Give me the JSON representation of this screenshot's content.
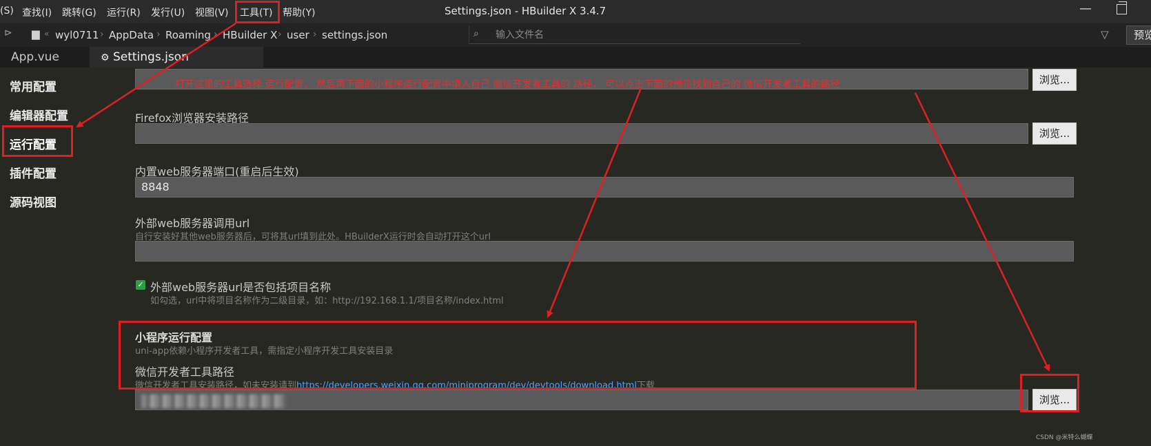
{
  "menu": {
    "items": [
      "(S)",
      "查找(I)",
      "跳转(G)",
      "运行(R)",
      "发行(U)",
      "视图(V)",
      "工具(T)",
      "帮助(Y)"
    ]
  },
  "window": {
    "title": "Settings.json - HBuilder X 3.4.7"
  },
  "address": {
    "crumbs": [
      "wyl0711",
      "AppData",
      "Roaming",
      "HBuilder X",
      "user",
      "settings.json"
    ],
    "file_search_placeholder": "输入文件名",
    "preview_label": "预览"
  },
  "tabs": [
    {
      "label": "App.vue"
    },
    {
      "label": "Settings.json",
      "active": true,
      "icon": "gear-icon"
    }
  ],
  "sidebar": {
    "items": [
      "常用配置",
      "编辑器配置",
      "运行配置",
      "插件配置",
      "源码视图"
    ],
    "selected": "运行配置"
  },
  "settings": {
    "browse_label": "浏览...",
    "annotation": "打开这里的工具选择 运行配置， 然后再下面的小程序运行配置中填入自己 微信开发者工具的 路径， 可以点击下面的预览找到自己的 微信开发者工具的路径",
    "firefox_label": "Firefox浏览器安装路径",
    "firefox_value": "",
    "web_port_label": "内置web服务器端口(重启后生效)",
    "web_port_value": "8848",
    "ext_web_label": "外部web服务器调用url",
    "ext_web_hint": "自行安装好其他web服务器后，可将其url填到此处。HBuilderX运行时会自动打开这个url",
    "ext_web_value": "",
    "include_project_label": "外部web服务器url是否包括项目名称",
    "include_project_checked": true,
    "include_project_hint": "如勾选，url中将项目名称作为二级目录，如：http://192.168.1.1/项目名称/index.html",
    "mini_section_title": "小程序运行配置",
    "mini_section_hint": "uni-app依赖小程序开发者工具，需指定小程序开发工具安装目录",
    "wechat_label": "微信开发者工具路径",
    "wechat_hint_prefix": "微信开发者工具安装路径，如未安装请到",
    "wechat_link": "https://developers.weixin.qq.com/miniprogram/dev/devtools/download.html",
    "wechat_hint_suffix": "下载"
  },
  "watermark": "CSDN @米特么蝴蝶",
  "colors": {
    "background": "#272822",
    "annotation_red": "#e02020",
    "checkbox_green": "#2e9e44",
    "link_blue": "#4aa3ff"
  }
}
